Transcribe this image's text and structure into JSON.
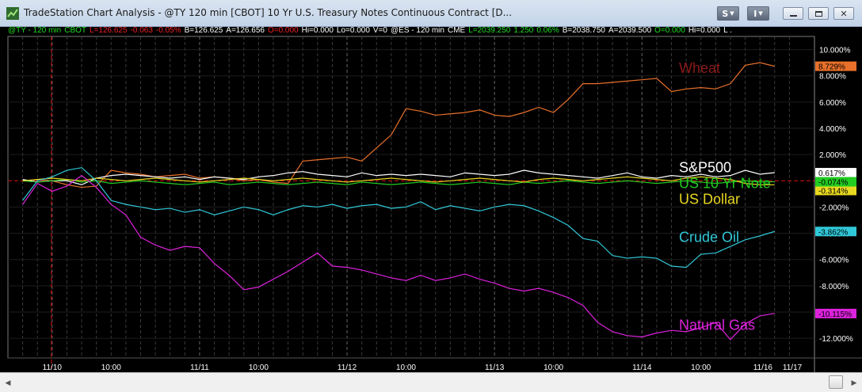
{
  "window": {
    "title": "TradeStation Chart Analysis - @TY 120 min [CBOT] 10 Yr U.S. Treasury Notes Continuous Contract [D...",
    "btn_s": "S",
    "btn_i": "I"
  },
  "status_line": [
    {
      "text": "@TY - 120 min",
      "color": "#22dd22"
    },
    {
      "text": "CBOT",
      "color": "#22dd22"
    },
    {
      "text": "L=126.625",
      "color": "#ee2222"
    },
    {
      "text": "-0.063",
      "color": "#ee2222"
    },
    {
      "text": "-0.05%",
      "color": "#ee2222"
    },
    {
      "text": "B=126.625",
      "color": "#ffffff"
    },
    {
      "text": "A=126.656",
      "color": "#ffffff"
    },
    {
      "text": "O=0.000",
      "color": "#ee2222"
    },
    {
      "text": "Hi=0.000",
      "color": "#ffffff"
    },
    {
      "text": "Lo=0.000",
      "color": "#ffffff"
    },
    {
      "text": "V=0",
      "color": "#ffffff"
    },
    {
      "text": "@ES - 120 min",
      "color": "#ffffff"
    },
    {
      "text": "CME",
      "color": "#ffffff"
    },
    {
      "text": "L=2039.250",
      "color": "#22dd22"
    },
    {
      "text": "1.250",
      "color": "#22dd22"
    },
    {
      "text": "0.06%",
      "color": "#22dd22"
    },
    {
      "text": "B=2038.750",
      "color": "#ffffff"
    },
    {
      "text": "A=2039.500",
      "color": "#ffffff"
    },
    {
      "text": "O=0.000",
      "color": "#22dd22"
    },
    {
      "text": "Hi=0.000",
      "color": "#ffffff"
    },
    {
      "text": "L .",
      "color": "#ffffff"
    }
  ],
  "chart_data": {
    "type": "line",
    "y_ticks": [
      "10.000%",
      "8.000%",
      "6.000%",
      "4.000%",
      "2.000%",
      "-2.000%",
      "-4.000%",
      "-6.000%",
      "-8.000%",
      "-10.000%",
      "-12.000%"
    ],
    "y_tick_values": [
      10,
      8,
      6,
      4,
      2,
      -2,
      -4,
      -6,
      -8,
      -10,
      -12
    ],
    "ylim": [
      -13.5,
      11
    ],
    "x_tick_labels": [
      {
        "label": "11/10",
        "x": 2
      },
      {
        "label": "10:00",
        "x": 6
      },
      {
        "label": "11/11",
        "x": 12
      },
      {
        "label": "10:00",
        "x": 16
      },
      {
        "label": "11/12",
        "x": 22
      },
      {
        "label": "10:00",
        "x": 26
      },
      {
        "label": "11/13",
        "x": 32
      },
      {
        "label": "10:00",
        "x": 36
      },
      {
        "label": "11/14",
        "x": 42
      },
      {
        "label": "10:00",
        "x": 46
      },
      {
        "label": "11/16",
        "x": 50.2
      },
      {
        "label": "11/17",
        "x": 52.2
      }
    ],
    "x_range": [
      -1,
      53.7
    ],
    "series": [
      {
        "name": "Wheat",
        "color": "#e8702a",
        "label_color": "#8b1a1a",
        "last_value": "8.729%",
        "badge_bg": "#e8702a",
        "badge_fg": "#000000",
        "values": [
          0,
          0.1,
          0,
          -0.3,
          -0.5,
          -0.4,
          0.8,
          0.6,
          0.5,
          0.3,
          0.4,
          0.5,
          0.2,
          0.3,
          0.2,
          0,
          0.1,
          -0.1,
          -0.2,
          1.5,
          1.6,
          1.7,
          1.8,
          1.5,
          2.5,
          3.5,
          5.5,
          5.3,
          5.0,
          5.1,
          5.2,
          5.4,
          5.0,
          4.9,
          5.2,
          5.6,
          5.2,
          6.2,
          7.4,
          7.4,
          7.5,
          7.6,
          7.7,
          7.8,
          6.8,
          7.0,
          7.1,
          7.0,
          7.4,
          8.8,
          9.0,
          8.73
        ]
      },
      {
        "name": "S&P500",
        "color": "#ffffff",
        "label_color": "#ffffff",
        "last_value": "0.617%",
        "badge_bg": "#ffffff",
        "badge_fg": "#000000",
        "values": [
          0.1,
          -0.1,
          0,
          0,
          -0.3,
          0.2,
          0.4,
          0.5,
          0.4,
          0.3,
          0.2,
          0.3,
          0.1,
          0.3,
          0.2,
          0.1,
          0.3,
          0.4,
          0.6,
          0.7,
          0.5,
          0.4,
          0.3,
          0.6,
          0.4,
          0.5,
          0.4,
          0.5,
          0.4,
          0.3,
          0.6,
          0.5,
          0.4,
          0.5,
          0.8,
          0.6,
          0.5,
          0.4,
          0.3,
          0.2,
          0.4,
          0.6,
          0.3,
          0.2,
          0.4,
          0.3,
          0.5,
          0.3,
          0.4,
          0.8,
          0.5,
          0.62
        ]
      },
      {
        "name": "US 10 Yr Note",
        "color": "#22cc22",
        "label_color": "#22cc22",
        "last_value": "-0.074%",
        "badge_bg": "#22cc22",
        "badge_fg": "#000000",
        "values": [
          0,
          -0.1,
          0,
          0.1,
          -0.1,
          0,
          -0.2,
          -0.1,
          0,
          -0.1,
          -0.2,
          -0.3,
          -0.2,
          -0.1,
          -0.3,
          -0.2,
          -0.1,
          -0.2,
          -0.3,
          -0.2,
          -0.1,
          -0.2,
          -0.3,
          -0.1,
          -0.2,
          -0.3,
          -0.2,
          -0.1,
          -0.2,
          -0.3,
          -0.2,
          -0.1,
          -0.2,
          -0.3,
          -0.1,
          -0.2,
          -0.1,
          0,
          -0.1,
          -0.2,
          -0.1,
          0,
          -0.1,
          -0.2,
          -0.1,
          0,
          -0.1,
          -0.2,
          -0.1,
          0,
          -0.1,
          -0.07
        ]
      },
      {
        "name": "US Dollar",
        "color": "#e8d820",
        "label_color": "#e8d820",
        "last_value": "-0.314%",
        "badge_bg": "#e8d820",
        "badge_fg": "#000000",
        "values": [
          0,
          0.1,
          0.2,
          0.1,
          0,
          0.2,
          0.1,
          0,
          0.1,
          0.2,
          0.1,
          0,
          -0.1,
          0,
          0.1,
          0.2,
          0.1,
          0,
          0.1,
          0.2,
          0.1,
          0,
          -0.1,
          0,
          0.1,
          0.2,
          0.1,
          0,
          -0.1,
          0,
          0.1,
          0.2,
          0.1,
          0,
          -0.1,
          0.1,
          0.2,
          0.1,
          0,
          0.1,
          0.2,
          0.3,
          0.2,
          0.1,
          0,
          0.2,
          0.3,
          0.2,
          0.1,
          -0.2,
          -0.3,
          -0.31
        ]
      },
      {
        "name": "Crude Oil",
        "color": "#30c8d8",
        "label_color": "#30c8d8",
        "last_value": "-3.862%",
        "badge_bg": "#30c8d8",
        "badge_fg": "#000000",
        "values": [
          -1.5,
          0,
          0.3,
          0.8,
          1.0,
          0,
          -1.5,
          -1.8,
          -2.0,
          -2.2,
          -2.1,
          -2.4,
          -2.2,
          -2.6,
          -2.3,
          -2.0,
          -2.2,
          -2.6,
          -2.2,
          -1.9,
          -2.0,
          -1.8,
          -2.1,
          -1.9,
          -1.8,
          -2.1,
          -2.0,
          -1.6,
          -2.2,
          -1.9,
          -2.1,
          -2.3,
          -2.0,
          -1.8,
          -1.9,
          -2.3,
          -2.8,
          -3.4,
          -4.4,
          -4.6,
          -5.7,
          -5.9,
          -5.8,
          -5.9,
          -6.5,
          -6.6,
          -5.6,
          -5.5,
          -5.0,
          -4.5,
          -4.2,
          -3.86
        ]
      },
      {
        "name": "Natural Gas",
        "color": "#dd22dd",
        "label_color": "#dd22dd",
        "last_value": "-10.115%",
        "badge_bg": "#dd22dd",
        "badge_fg": "#000000",
        "values": [
          -1.8,
          -0.2,
          -0.8,
          -0.4,
          0.4,
          -0.5,
          -1.8,
          -2.6,
          -4.3,
          -4.9,
          -5.3,
          -5.0,
          -5.1,
          -6.3,
          -7.2,
          -8.3,
          -8.1,
          -7.5,
          -6.9,
          -6.2,
          -5.5,
          -6.5,
          -6.6,
          -6.8,
          -7.1,
          -7.4,
          -7.6,
          -7.2,
          -7.6,
          -7.4,
          -7.1,
          -7.5,
          -7.8,
          -8.2,
          -8.4,
          -8.2,
          -8.5,
          -8.9,
          -9.5,
          -10.8,
          -11.5,
          -11.8,
          -11.9,
          -11.6,
          -11.4,
          -11.5,
          -11.2,
          -10.8,
          -12.1,
          -10.9,
          -10.3,
          -10.1
        ]
      }
    ],
    "series_label_y": {
      "Wheat": 8.6,
      "S&P500": 1.0,
      "US 10 Yr Note": -0.2,
      "US Dollar": -1.4,
      "Crude Oil": -4.3,
      "Natural Gas": -11.0
    }
  }
}
